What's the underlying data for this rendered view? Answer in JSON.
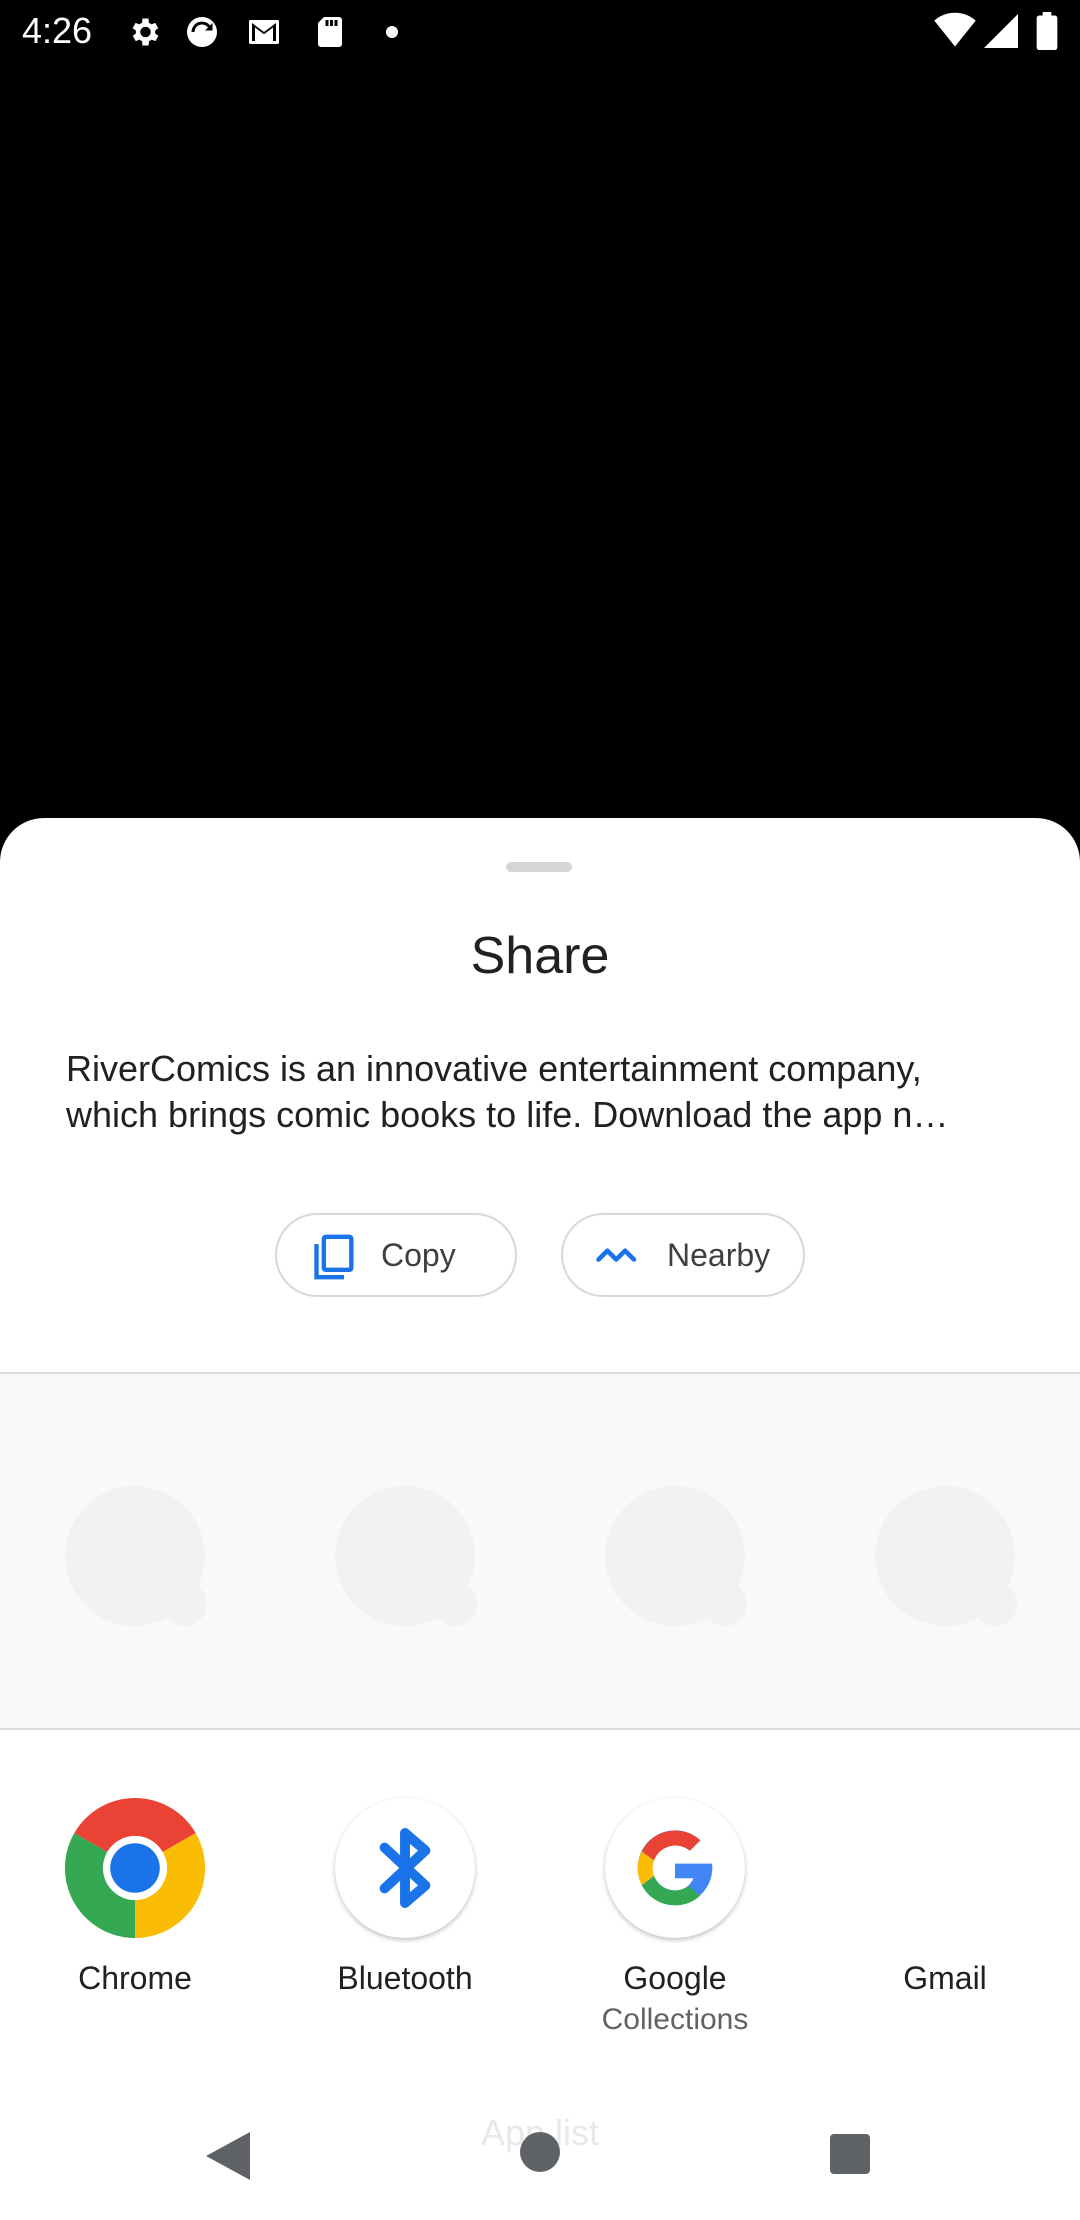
{
  "status_bar": {
    "time": "4:26",
    "left_icons": [
      "settings-icon",
      "vpn-sync-icon",
      "gmail-icon",
      "sd-card-icon",
      "dot-icon"
    ],
    "right_icons": [
      "wifi-icon",
      "signal-icon",
      "battery-icon"
    ]
  },
  "sheet": {
    "title": "Share",
    "description_line1": "RiverComics is an innovative entertainment company,",
    "description_line2": "which brings comic books to life. Download the app n…",
    "actions": {
      "copy_label": "Copy",
      "nearby_label": "Nearby"
    },
    "apps": [
      {
        "name": "Chrome",
        "sub": ""
      },
      {
        "name": "Bluetooth",
        "sub": ""
      },
      {
        "name": "Google",
        "sub": "Collections"
      },
      {
        "name": "Gmail",
        "sub": ""
      }
    ],
    "colors": {
      "accent": "#1a73e8",
      "google_red": "#ea4335",
      "google_yellow": "#fbbc04",
      "google_green": "#34a853",
      "google_blue": "#4285f4"
    }
  },
  "navbar": {
    "overlay_text": "App list"
  }
}
